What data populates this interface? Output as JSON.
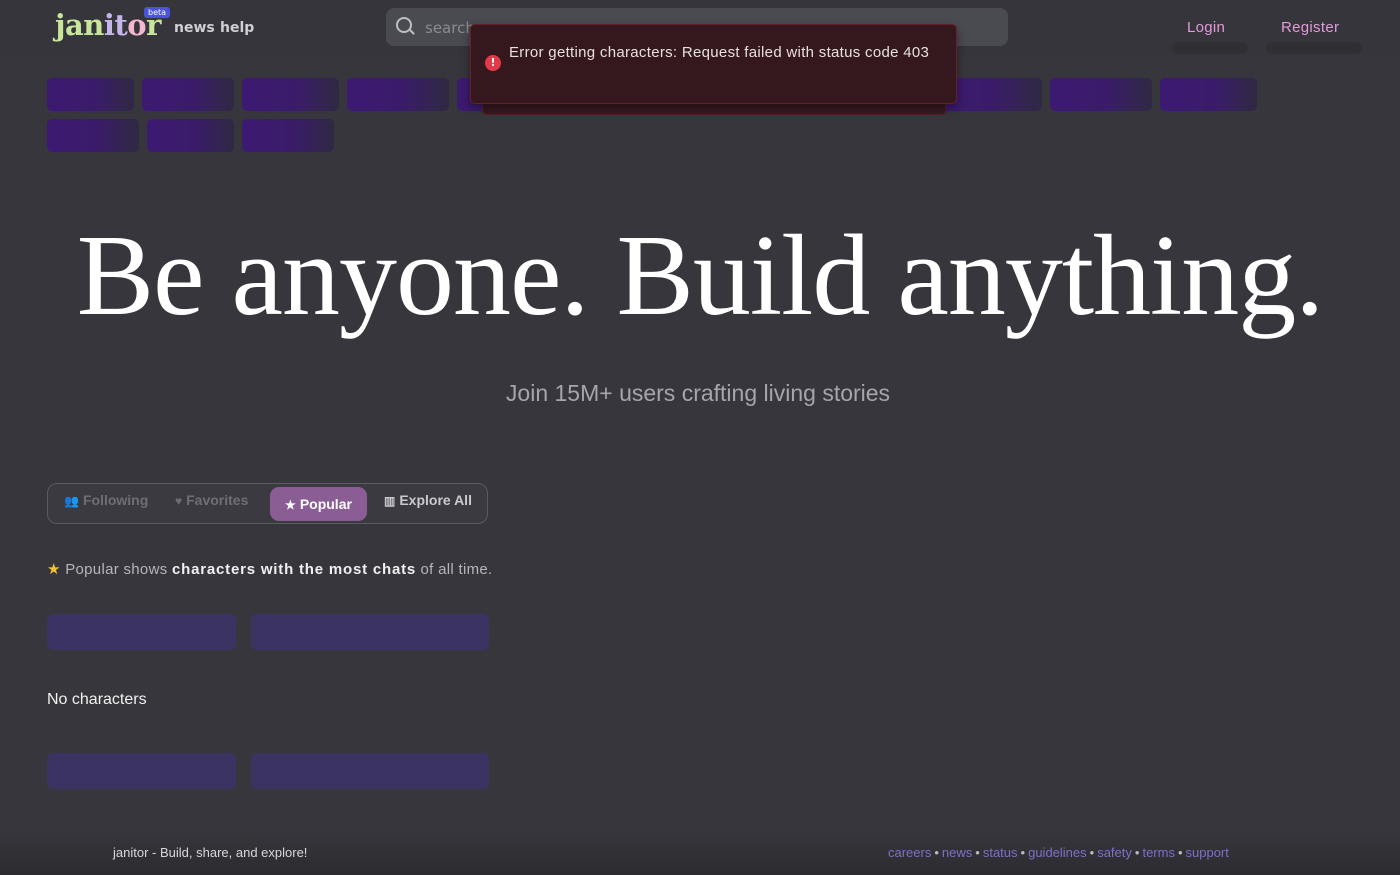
{
  "header": {
    "logo": "janitor",
    "badge": "beta",
    "nav": [
      "news",
      "help"
    ],
    "search_placeholder": "search",
    "login": "Login",
    "register": "Register"
  },
  "toast": {
    "message": "Error getting characters: Request failed with status code 403",
    "icon": "alert-circle-icon",
    "color": "#e23b47"
  },
  "hero": {
    "title": "Be anyone. Build anything.",
    "subtitle": "Join 15M+ users crafting living stories"
  },
  "tabs": [
    {
      "label": "Following",
      "icon": "people-icon",
      "active": false
    },
    {
      "label": "Favorites",
      "icon": "heart-icon",
      "active": false
    },
    {
      "label": "Popular",
      "icon": "star-icon",
      "active": true
    },
    {
      "label": "Explore All",
      "icon": "library-icon",
      "active": false
    }
  ],
  "description": {
    "prefix": "Popular shows",
    "bold": "characters with the most chats",
    "suffix": "of all time."
  },
  "empty_state": "No characters",
  "footer": {
    "brand": "janitor",
    "tagline": "- Build, share, and explore!",
    "links": [
      "careers",
      "news",
      "status",
      "guidelines",
      "safety",
      "terms",
      "support"
    ]
  },
  "colors": {
    "accent": "#8a5d95",
    "link": "#e29ad9",
    "background": "#36363c"
  }
}
